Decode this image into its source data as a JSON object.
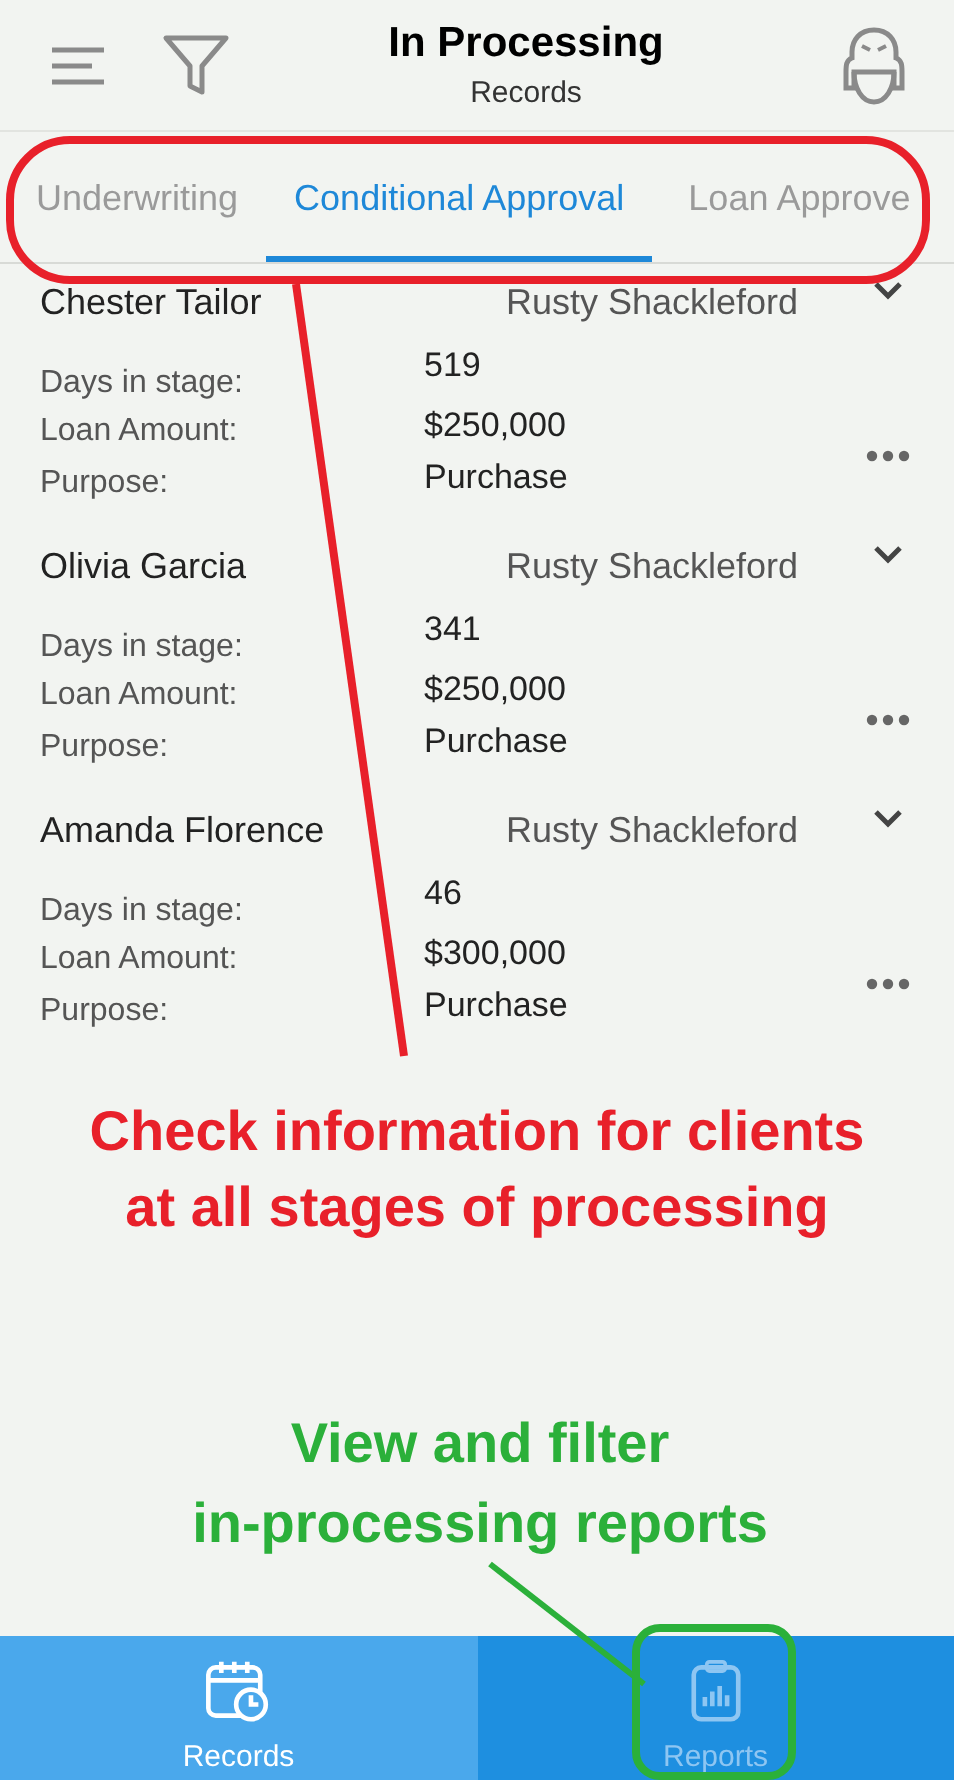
{
  "header": {
    "title": "In Processing",
    "subtitle": "Records"
  },
  "tabs": [
    {
      "label": "Underwriting",
      "selected": false
    },
    {
      "label": "Conditional Approval",
      "selected": true
    },
    {
      "label": "Loan Approve",
      "selected": false
    }
  ],
  "records": [
    {
      "name": "Chester Tailor",
      "agent": "Rusty Shackleford",
      "fields": [
        {
          "label": "Days in stage:",
          "value": "519"
        },
        {
          "label": "Loan Amount:",
          "value": "$250,000"
        },
        {
          "label": "Purpose:",
          "value": "Purchase"
        }
      ]
    },
    {
      "name": "Olivia Garcia",
      "agent": "Rusty Shackleford",
      "fields": [
        {
          "label": "Days in stage:",
          "value": "341"
        },
        {
          "label": "Loan Amount:",
          "value": "$250,000"
        },
        {
          "label": "Purpose:",
          "value": "Purchase"
        }
      ]
    },
    {
      "name": "Amanda Florence",
      "agent": "Rusty Shackleford",
      "fields": [
        {
          "label": "Days in stage:",
          "value": "46"
        },
        {
          "label": "Loan Amount:",
          "value": "$300,000"
        },
        {
          "label": "Purpose:",
          "value": "Purchase"
        }
      ]
    }
  ],
  "bottom_nav": [
    {
      "label": "Records",
      "selected": true
    },
    {
      "label": "Reports",
      "selected": false
    }
  ],
  "annotations": [
    {
      "lines": [
        "Check information for clients",
        "at all stages of processing"
      ],
      "color": "#e8202a"
    },
    {
      "lines": [
        "View and filter",
        "in-processing reports"
      ],
      "color": "#2bb03a"
    }
  ]
}
